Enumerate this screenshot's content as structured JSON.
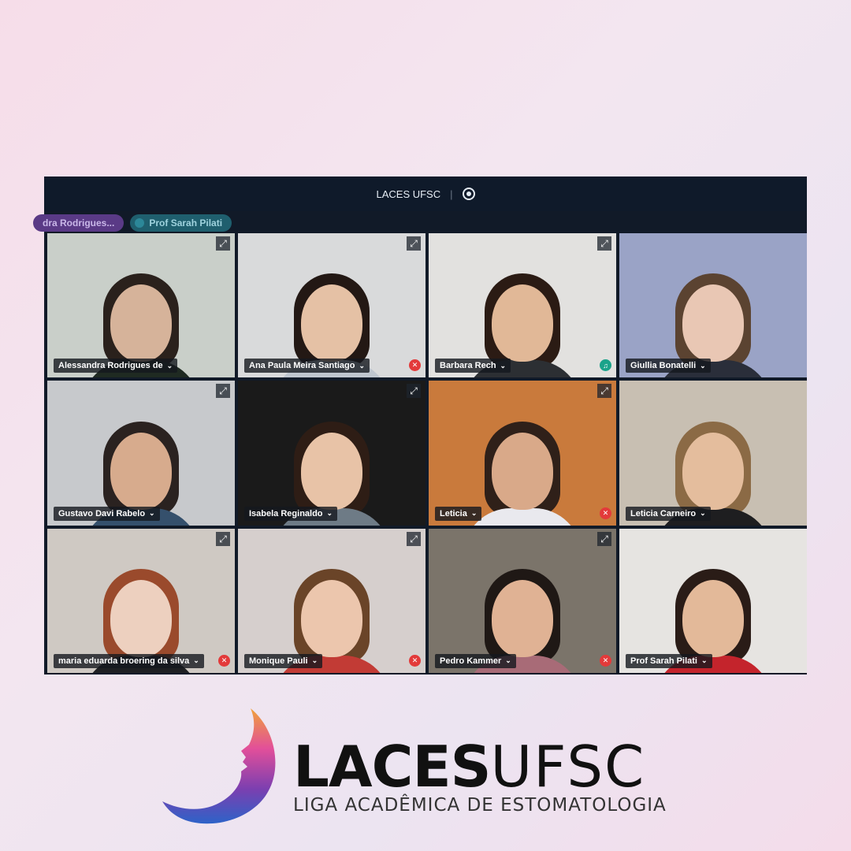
{
  "topbar": {
    "title": "LACES UFSC",
    "record_icon": "record-icon"
  },
  "pills": [
    {
      "label": "dra Rodrigues...",
      "color": "#5a3a86"
    },
    {
      "label": "Prof Sarah Pilati",
      "color": "#1f5f6e"
    }
  ],
  "participants": [
    {
      "name": "Alessandra Rodrigues de",
      "bg": "#c9cfc9",
      "skin": "#d6b39a",
      "hair": "#2a211c",
      "shirt": "#1f2a22",
      "badge": ""
    },
    {
      "name": "Ana Paula Meira Santiago",
      "bg": "#d9dadb",
      "skin": "#e5c1a5",
      "hair": "#231814",
      "shirt": "#bfc6cf",
      "badge": "mic-off"
    },
    {
      "name": "Barbara Rech",
      "bg": "#e2e1df",
      "skin": "#e1b897",
      "hair": "#2b1b14",
      "shirt": "#2c2f33",
      "badge": "headset"
    },
    {
      "name": "Giullia Bonatelli",
      "bg": "#9aa3c6",
      "skin": "#e9c7b4",
      "hair": "#5b4331",
      "shirt": "#2a2e3a",
      "badge": ""
    },
    {
      "name": "Gustavo Davi Rabelo",
      "bg": "#c7c9cc",
      "skin": "#d7ab8d",
      "hair": "#2a2220",
      "shirt": "#35506c",
      "badge": ""
    },
    {
      "name": "Isabela Reginaldo",
      "bg": "#1a1a1a",
      "skin": "#e8c3a7",
      "hair": "#2e1d15",
      "shirt": "#6e7b86",
      "badge": ""
    },
    {
      "name": "Leticia",
      "bg": "#c97a3c",
      "skin": "#d9a989",
      "hair": "#2f2019",
      "shirt": "#e9e9ee",
      "badge": "mic-off"
    },
    {
      "name": "Leticia Carneiro",
      "bg": "#c8bfb2",
      "skin": "#e4bd9d",
      "hair": "#8b6a45",
      "shirt": "#1e1e20",
      "badge": ""
    },
    {
      "name": "maria eduarda broering da silva",
      "bg": "#cfc9c3",
      "skin": "#edd0bf",
      "hair": "#9a4a2c",
      "shirt": "#1f2023",
      "badge": "mic-off"
    },
    {
      "name": "Monique Pauli",
      "bg": "#d6cfcd",
      "skin": "#ecc6ad",
      "hair": "#6a4428",
      "shirt": "#c23b35",
      "badge": "mic-off"
    },
    {
      "name": "Pedro Kammer",
      "bg": "#7b746a",
      "skin": "#e0b294",
      "hair": "#1f1815",
      "shirt": "#a86b77",
      "badge": "mic-off"
    },
    {
      "name": "Prof Sarah Pilati",
      "bg": "#e6e4e1",
      "skin": "#e3b999",
      "hair": "#2a1c17",
      "shirt": "#c4242c",
      "badge": ""
    }
  ],
  "logo": {
    "bold": "LACES",
    "light": "UFSC",
    "tagline": "LIGA ACADÊMICA DE ESTOMATOLOGIA",
    "colors": {
      "pink": "#e24f9a",
      "purple": "#7b3fb0",
      "blue": "#2d63c8",
      "orange": "#f0a23a"
    }
  }
}
